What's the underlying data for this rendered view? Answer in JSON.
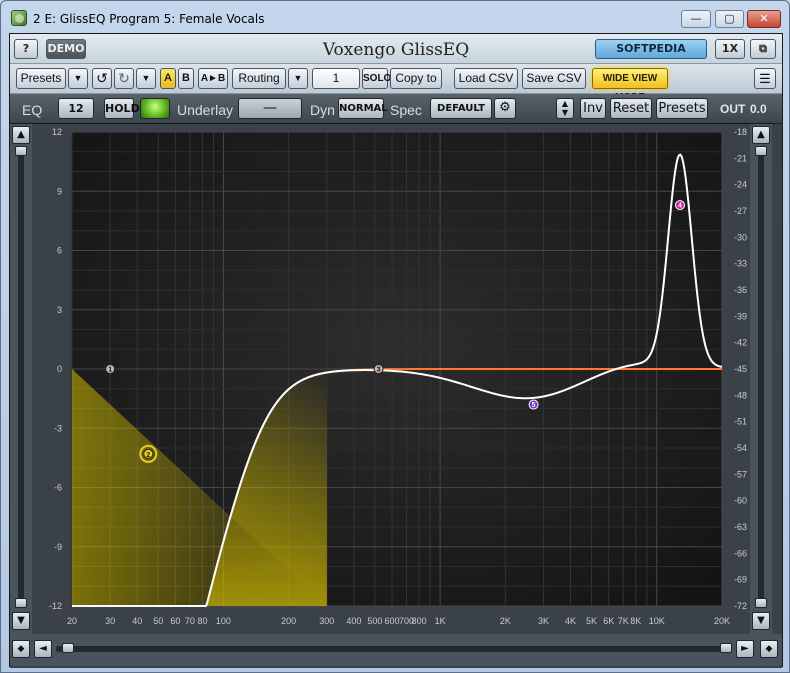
{
  "window": {
    "title": "2 E: GlissEQ Program 5: Female Vocals",
    "minimize": "—",
    "maximize": "▢",
    "close": "✕"
  },
  "header": {
    "help": "?",
    "demo": "DEMO",
    "title": "Voxengo GlissEQ",
    "softpedia": "SOFTPEDIA",
    "scale": "1X",
    "restore": "⧉"
  },
  "toolbar": {
    "presets": "Presets",
    "dropdown": "▼",
    "undo": "↺",
    "redo": "↻",
    "a": "A",
    "b": "B",
    "ab": "A►B",
    "routing": "Routing",
    "channel": "1",
    "solo": "SOLO",
    "copy_to": "Copy to",
    "load_csv": "Load CSV",
    "save_csv": "Save CSV",
    "wide_view": "WIDE VIEW MODE",
    "menu": "☰"
  },
  "eqbar": {
    "eq_label": "EQ",
    "range": "12 DB",
    "hold": "HOLD",
    "underlay_label": "Underlay",
    "underlay_value": "—",
    "dyn_label": "Dyn",
    "dyn_value": "NORMAL",
    "spec_label": "Spec",
    "spec_value": "DEFAULT",
    "inv": "Inv",
    "reset": "Reset",
    "presets": "Presets",
    "out_label": "OUT",
    "out_value": "0.0"
  },
  "plot": {
    "left_axis": [
      "12",
      "9",
      "6",
      "3",
      "0",
      "-3",
      "-6",
      "-9",
      "-12"
    ],
    "right_axis": [
      "-18",
      "-21",
      "-24",
      "-27",
      "-30",
      "-33",
      "-36",
      "-39",
      "-42",
      "-45",
      "-48",
      "-51",
      "-54",
      "-57",
      "-60",
      "-63",
      "-66",
      "-69",
      "-72"
    ],
    "freq_labels": [
      "20",
      "30",
      "40",
      "50",
      "60",
      "70",
      "80",
      "100",
      "200",
      "300",
      "400",
      "500",
      "600",
      "700",
      "800",
      "1K",
      "2K",
      "3K",
      "4K",
      "5K",
      "6K",
      "7K",
      "8K",
      "10K",
      "20K"
    ],
    "bands": [
      {
        "id": "1",
        "label": "1",
        "freq": 30,
        "gain": 0
      },
      {
        "id": "2",
        "label": "2",
        "freq": 45,
        "gain": -4.3
      },
      {
        "id": "3",
        "label": "3",
        "freq": 520,
        "gain": 0
      },
      {
        "id": "4",
        "label": "4",
        "freq": 12800,
        "gain": 8.3
      },
      {
        "id": "5",
        "label": "5",
        "freq": 2700,
        "gain": -1.8
      }
    ],
    "colors": {
      "curve": "#ffffff",
      "dynamic_curve": "#ff7a30",
      "filter_fill": "#c8b400",
      "band_4": "#d01ca0",
      "band_5": "#7a30d0"
    }
  },
  "scrollbars": {
    "up": "▲",
    "down": "▼",
    "left": "◄",
    "right": "►",
    "diamond": "◆"
  }
}
